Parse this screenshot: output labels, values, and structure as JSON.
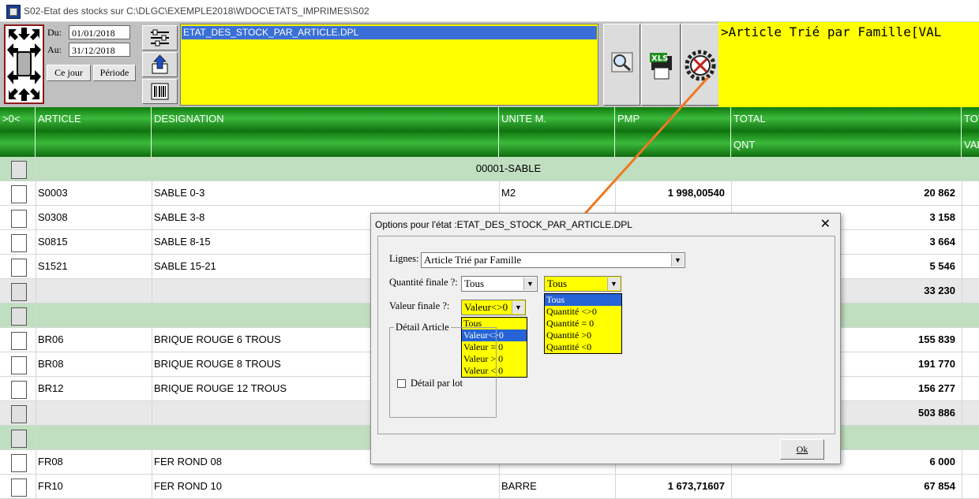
{
  "window": {
    "title": "S02-Etat des stocks sur C:\\DLGC\\EXEMPLE2018\\WDOC\\ETATS_IMPRIMES\\S02"
  },
  "toolbar": {
    "du_label": "Du:",
    "du_value": "01/01/2018",
    "au_label": "Au:",
    "au_value": "31/12/2018",
    "ce_jour_label": "Ce jour",
    "periode_label": "Période",
    "report_selected": "ETAT_DES_STOCK_PAR_ARTICLE.DPL",
    "title_text": ">Article Trié par Famille[VAL"
  },
  "grid": {
    "headers": [
      ">0<",
      "ARTICLE",
      "DESIGNATION",
      "UNITE M.",
      "PMP",
      "TOTAL",
      "TOT"
    ],
    "subheaders": [
      "QNT",
      "VAL"
    ],
    "rows": [
      {
        "type": "group",
        "label": "00001-SABLE"
      },
      {
        "type": "item",
        "article": "S0003",
        "designation": "SABLE 0-3",
        "unite": "M2",
        "pmp": "1 998,00540",
        "total": "20 862"
      },
      {
        "type": "item",
        "article": "S0308",
        "designation": "SABLE 3-8",
        "unite": "",
        "pmp": "",
        "total": "3 158"
      },
      {
        "type": "item",
        "article": "S0815",
        "designation": "SABLE 8-15",
        "unite": "",
        "pmp": "",
        "total": "3 664"
      },
      {
        "type": "item",
        "article": "S1521",
        "designation": "SABLE 15-21",
        "unite": "",
        "pmp": "",
        "total": "5 546"
      },
      {
        "type": "total",
        "total": "33 230"
      },
      {
        "type": "group",
        "label": ""
      },
      {
        "type": "item",
        "article": "BR06",
        "designation": "BRIQUE ROUGE 6 TROUS",
        "unite": "",
        "pmp": "",
        "total": "155 839"
      },
      {
        "type": "item",
        "article": "BR08",
        "designation": "BRIQUE ROUGE 8 TROUS",
        "unite": "",
        "pmp": "",
        "total": "191 770"
      },
      {
        "type": "item",
        "article": "BR12",
        "designation": "BRIQUE ROUGE 12 TROUS",
        "unite": "",
        "pmp": "",
        "total": "156 277"
      },
      {
        "type": "total",
        "total": "503 886"
      },
      {
        "type": "group",
        "label": ""
      },
      {
        "type": "item",
        "article": "FR08",
        "designation": "FER ROND 08",
        "unite": "",
        "pmp": "",
        "total": "6 000"
      },
      {
        "type": "item",
        "article": "FR10",
        "designation": "FER ROND 10",
        "unite": "BARRE",
        "pmp": "1 673,71607",
        "total": "67 854"
      }
    ]
  },
  "dialog": {
    "title": "Options pour l'état :ETAT_DES_STOCK_PAR_ARTICLE.DPL",
    "close": "✕",
    "lignes_label": "Lignes:",
    "lignes_value": "Article Trié par Famille",
    "qte_label": "Quantité finale ?:",
    "qte_value": "Tous",
    "qte2_value": "Tous",
    "qte_options": [
      "Tous",
      "Quantité <>0",
      "Quantité = 0",
      "Quantité >0",
      "Quantité <0"
    ],
    "val_label": "Valeur finale ?:",
    "val_value": "Valeur<>0",
    "val_options": [
      "Tous",
      "Valeur<>0",
      "Valeur = 0",
      "Valeur > 0",
      "Valeur < 0"
    ],
    "detail_group": "Détail Article",
    "detail_lot": "Détail par lot",
    "ok": "Ok"
  },
  "colors": {
    "grid_header": "#1e8f1e",
    "group_row": "#c0dfc0",
    "highlight": "#ffff00",
    "selection": "#2563d6",
    "arrow": "#f07820"
  }
}
